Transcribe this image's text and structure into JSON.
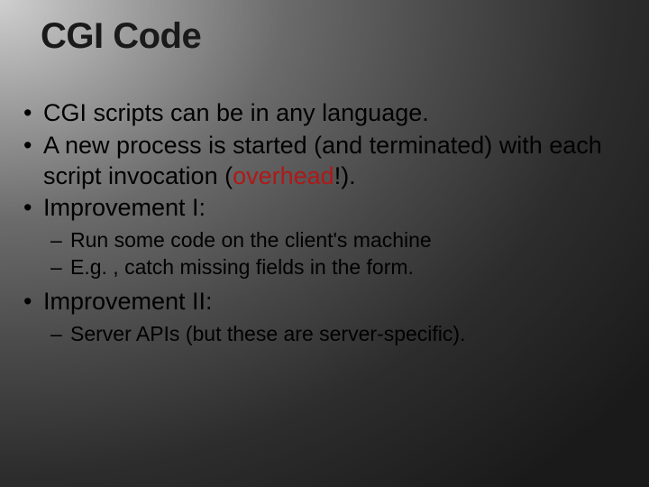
{
  "title": "CGI Code",
  "bullets": [
    {
      "text": "CGI scripts can be in any language."
    },
    {
      "pre": "A new process is started (and terminated) with each script invocation (",
      "hl": "overhead",
      "post": "!)."
    },
    {
      "text": "Improvement I:",
      "sub": [
        "Run some code on the client's machine",
        "E.g. , catch missing fields in the form."
      ]
    },
    {
      "text": "Improvement II:",
      "sub": [
        "Server APIs (but these are server-specific)."
      ]
    }
  ]
}
